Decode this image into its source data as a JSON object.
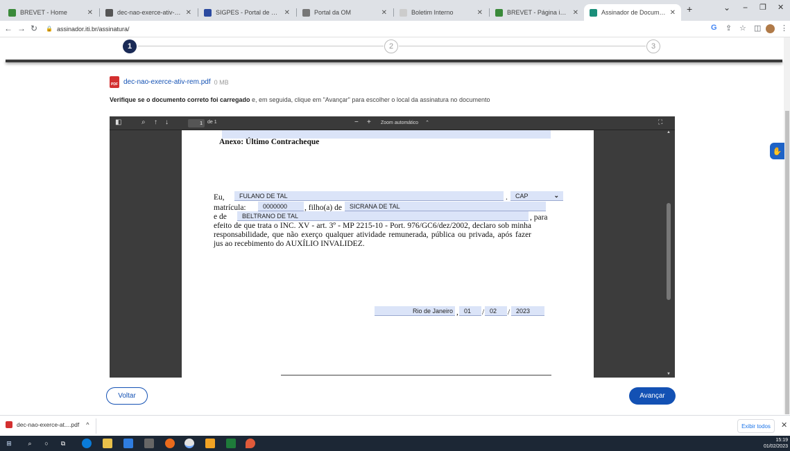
{
  "browser": {
    "tabs": [
      {
        "title": "BREVET - Home",
        "color": "#3a8a3a"
      },
      {
        "title": "dec-nao-exerce-ativ-rem.pdf",
        "color": "#555555"
      },
      {
        "title": "SIGPES - Portal de Serviços TI",
        "color": "#2b4aa0"
      },
      {
        "title": "Portal da OM",
        "color": "#777777"
      },
      {
        "title": "Boletim Interno",
        "color": "#cccccc"
      },
      {
        "title": "BREVET - Página inicial",
        "color": "#3a8a3a"
      },
      {
        "title": "Assinador de Documentos | Ass",
        "color": "#1b8f7a"
      }
    ],
    "new_tab": "+",
    "url": "assinador.iti.br/assinatura/",
    "window_controls": {
      "minimize": "−",
      "restore": "❐",
      "close": "✕",
      "dropdown": "⌄"
    }
  },
  "stepper": {
    "steps": [
      "1",
      "2",
      "3"
    ],
    "active": 1
  },
  "file": {
    "name": "dec-nao-exerce-ativ-rem.pdf",
    "size": "0 MB",
    "icon": "pdf-file-icon",
    "icon_label": "PDF"
  },
  "instruction": {
    "bold": "Verifique se o documento correto foi carregado",
    "rest": " e, em seguida, clique em \"Avançar\" para escolher o local da assinatura no documento"
  },
  "viewer": {
    "page_number": "1",
    "page_of": "de 1",
    "zoom_minus": "−",
    "zoom_plus": "+",
    "zoom_label": "Zoom automático",
    "zoom_caret": "⌃"
  },
  "document": {
    "heading": "Anexo: Último Contracheque",
    "eu_label": "Eu,",
    "name_value": "FULANO DE TAL",
    "rank_value": "CAP",
    "matricula_label": "matrícula:",
    "matricula_value": "0000000",
    "filho_label": ", filho(a) de",
    "mother_value": "SICRANA DE TAL",
    "e_de_label": "e de",
    "father_value": "BELTRANO DE TAL",
    "para_label": ", para",
    "body": "efeito de que trata o INC. XV - art. 3º - MP 2215-10 - Port. 976/GC6/dez/2002, declaro sob minha responsabilidade, que não exerço qualquer atividade remunerada, pública ou privada, após fazer jus ao recebimento do AUXÍLIO INVALIDEZ.",
    "city_value": "Rio de Janeiro",
    "day_value": "01",
    "month_value": "02",
    "year_value": "2023"
  },
  "buttons": {
    "back": "Voltar",
    "next": "Avançar"
  },
  "download_bar": {
    "item": "dec-nao-exerce-at....pdf",
    "caret": "^",
    "show_all": "Exibir todos",
    "close": "✕"
  },
  "taskbar": {
    "time": "15:19",
    "date": "01/02/2023"
  },
  "colors": {
    "primary": "#1351b4",
    "stepper_active": "#1a2a56",
    "field_bg": "#dbe4f8"
  }
}
